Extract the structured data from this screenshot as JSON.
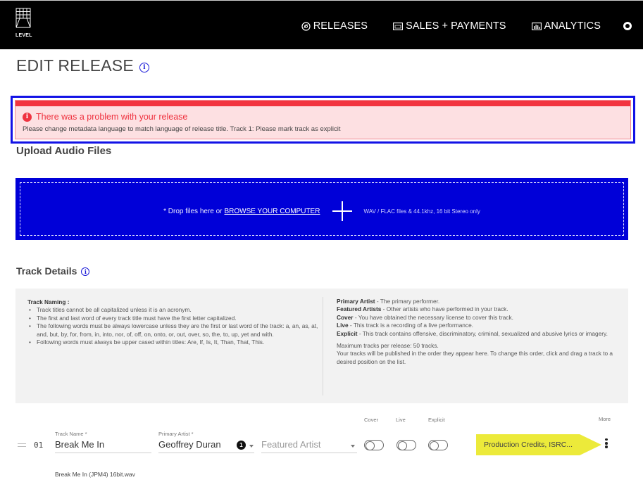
{
  "app": {
    "logo_text": "LEVEL"
  },
  "nav": {
    "items": [
      {
        "label": "RELEASES",
        "icon": "disc-icon"
      },
      {
        "label": "SALES + PAYMENTS",
        "icon": "money-icon"
      },
      {
        "label": "ANALYTICS",
        "icon": "bar-chart-icon"
      }
    ],
    "user_icon": "user-circle-icon"
  },
  "page": {
    "title": "EDIT RELEASE",
    "title_info_icon": "info-icon"
  },
  "error": {
    "title": "There was a problem with your release",
    "message": "Please change metadata language to match language of release title. Track 1: Please mark track as explicit",
    "icon": "alert-icon",
    "color": "#ef3340",
    "focus_border_color": "#1212e6"
  },
  "upload": {
    "section_title": "Upload Audio Files",
    "drop_text": "* Drop files here or",
    "browse_link": "BROWSE YOUR COMPUTER",
    "format_note": "WAV / FLAC files & 44.1khz, 16 bit Stereo only",
    "icon": "plus-icon",
    "background_color": "#0000d8"
  },
  "track_details": {
    "section_title": "Track Details",
    "naming": {
      "heading": "Track Naming :",
      "rules": [
        "Track titles cannot be all capitalized unless it is an acronym.",
        "The first and last word of every track title must have the first letter capitalized.",
        "The following words must be always lowercase unless they are the first or last word of the track: a, an, as, at, and, but, by, for, from, in, into, nor, of, off, on, onto, or, out, over, so, the, to, up, yet and with.",
        "Following words must always be upper cased within titles: Are, If, Is, It, Than, That, This."
      ]
    },
    "definitions": [
      {
        "term": "Primary Artist",
        "desc": " - The primary performer."
      },
      {
        "term": "Featured Artists",
        "desc": " - Other artists who have performed in your track."
      },
      {
        "term": "Cover",
        "desc": " - You have obtained the necessary license to cover this track."
      },
      {
        "term": "Live",
        "desc": " - This track is a recording of a live performance."
      },
      {
        "term": "Explicit",
        "desc": " - This track contains offensive, discriminatory, criminal, sexualized and abusive lyrics or imagery."
      }
    ],
    "max_tracks_note": "Maximum tracks per release: 50 tracks.",
    "order_note": "Your tracks will be published in the order they appear here. To change this order, click and drag a track to a desired position on the list."
  },
  "track_table": {
    "columns": {
      "track_name": "Track Name *",
      "primary_artist": "Primary Artist *",
      "cover": "Cover",
      "live": "Live",
      "explicit": "Explicit",
      "more": "More"
    },
    "tracks": [
      {
        "number": "01",
        "name": "Break Me In",
        "primary_artist": "Geoffrey Duran",
        "artist_count": "1",
        "featured_artist_placeholder": "Featured Artist",
        "cover": false,
        "live": false,
        "explicit": false,
        "credits_button": "Production Credits, ISRC...",
        "file_name": "Break Me In (JPM4) 16bit.wav"
      }
    ],
    "credits_color": "#ecea3a"
  }
}
